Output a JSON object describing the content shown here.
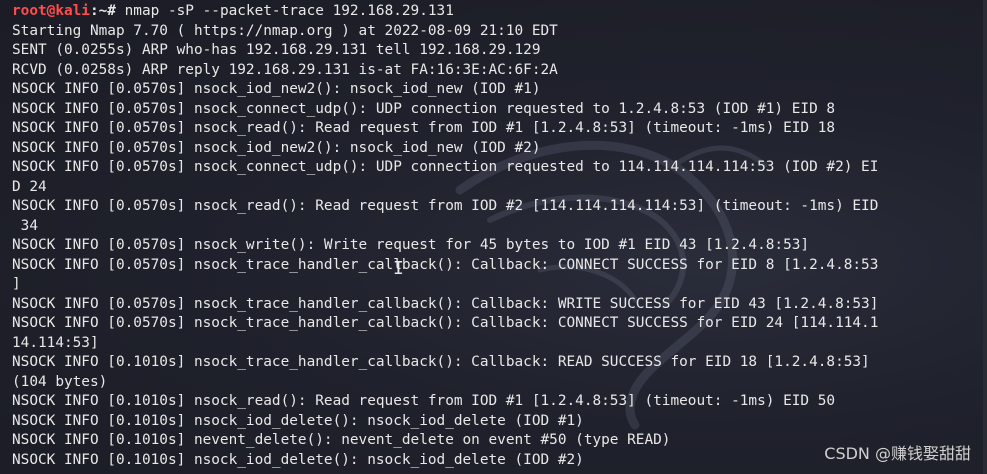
{
  "prompt": {
    "user_host": "root@kali",
    "path_symbol": ":~#",
    "command": " nmap -sP --packet-trace 192.168.29.131"
  },
  "output_lines": [
    "Starting Nmap 7.70 ( https://nmap.org ) at 2022-08-09 21:10 EDT",
    "SENT (0.0255s) ARP who-has 192.168.29.131 tell 192.168.29.129",
    "RCVD (0.0258s) ARP reply 192.168.29.131 is-at FA:16:3E:AC:6F:2A",
    "NSOCK INFO [0.0570s] nsock_iod_new2(): nsock_iod_new (IOD #1)",
    "NSOCK INFO [0.0570s] nsock_connect_udp(): UDP connection requested to 1.2.4.8:53 (IOD #1) EID 8",
    "NSOCK INFO [0.0570s] nsock_read(): Read request from IOD #1 [1.2.4.8:53] (timeout: -1ms) EID 18",
    "NSOCK INFO [0.0570s] nsock_iod_new2(): nsock_iod_new (IOD #2)",
    "NSOCK INFO [0.0570s] nsock_connect_udp(): UDP connection requested to 114.114.114.114:53 (IOD #2) EI",
    "D 24",
    "NSOCK INFO [0.0570s] nsock_read(): Read request from IOD #2 [114.114.114.114:53] (timeout: -1ms) EID",
    " 34",
    "NSOCK INFO [0.0570s] nsock_write(): Write request for 45 bytes to IOD #1 EID 43 [1.2.4.8:53]",
    "NSOCK INFO [0.0570s] nsock_trace_handler_callback(): Callback: CONNECT SUCCESS for EID 8 [1.2.4.8:53",
    "]",
    "NSOCK INFO [0.0570s] nsock_trace_handler_callback(): Callback: WRITE SUCCESS for EID 43 [1.2.4.8:53]",
    "NSOCK INFO [0.0570s] nsock_trace_handler_callback(): Callback: CONNECT SUCCESS for EID 24 [114.114.1",
    "14.114:53]",
    "NSOCK INFO [0.1010s] nsock_trace_handler_callback(): Callback: READ SUCCESS for EID 18 [1.2.4.8:53]",
    "(104 bytes)",
    "NSOCK INFO [0.1010s] nsock_read(): Read request from IOD #1 [1.2.4.8:53] (timeout: -1ms) EID 50",
    "NSOCK INFO [0.1010s] nsock_iod_delete(): nsock_iod_delete (IOD #1)",
    "NSOCK INFO [0.1010s] nevent_delete(): nevent_delete on event #50 (type READ)",
    "NSOCK INFO [0.1010s] nsock_iod_delete(): nsock_iod_delete (IOD #2)"
  ],
  "watermark": "CSDN @赚钱娶甜甜",
  "colors": {
    "background": "#1e1f29",
    "text": "#e8e8e8",
    "prompt_user": "#ff4d4d"
  },
  "icons": {
    "cursor": "text-cursor-icon",
    "background": "kali-dragon-icon"
  }
}
